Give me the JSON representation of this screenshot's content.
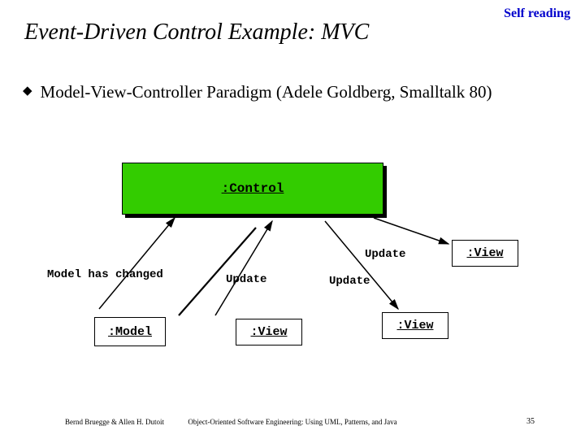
{
  "header": {
    "self_reading": "Self reading",
    "title": "Event-Driven Control Example: MVC"
  },
  "bullet": {
    "mark": "◆",
    "text": "Model-View-Controller Paradigm (Adele Goldberg, Smalltalk 80)"
  },
  "diagram": {
    "control": ":Control",
    "model": ":Model",
    "view1": ":View",
    "view2": ":View",
    "view3": ":View",
    "label_model_changed": "Model has changed",
    "label_update_1": "Update",
    "label_update_2": "Update",
    "label_update_3": "Update"
  },
  "footer": {
    "left": "Bernd Bruegge & Allen H. Dutoit",
    "center": "Object-Oriented Software Engineering: Using UML, Patterns, and Java",
    "page": "35"
  }
}
